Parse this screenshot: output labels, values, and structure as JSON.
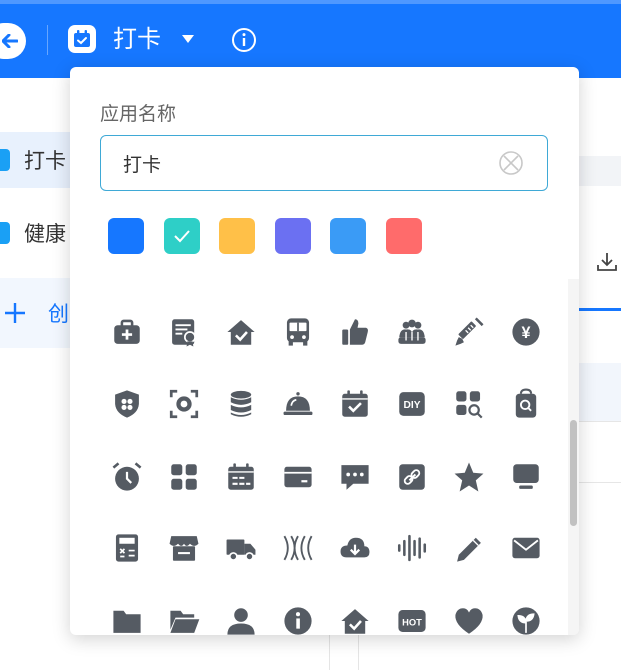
{
  "header": {
    "app_title": "打卡",
    "accent": "#1677ff"
  },
  "sidebar": {
    "items": [
      {
        "label": "打卡",
        "active": true
      },
      {
        "label": "健康",
        "active": false
      }
    ],
    "create_label": "创"
  },
  "popup": {
    "name_label": "应用名称",
    "name_value": "打卡",
    "colors": [
      {
        "name": "blue",
        "hex": "#1677ff",
        "selected": false
      },
      {
        "name": "teal",
        "hex": "#2ecfc7",
        "selected": true
      },
      {
        "name": "orange",
        "hex": "#ffc048",
        "selected": false
      },
      {
        "name": "indigo",
        "hex": "#6b70f2",
        "selected": false
      },
      {
        "name": "sky",
        "hex": "#3a9bf6",
        "selected": false
      },
      {
        "name": "red",
        "hex": "#ff6b6b",
        "selected": false
      }
    ],
    "icons": [
      "medical-kit-icon",
      "certificate-icon",
      "home-check-icon",
      "bus-icon",
      "thumbs-up-icon",
      "group-icon",
      "syringe-icon",
      "yen-icon",
      "shield-icon",
      "focus-icon",
      "database-icon",
      "service-bell-icon",
      "calendar-check-icon",
      "diy-icon",
      "apps-search-icon",
      "search-bag-icon",
      "alarm-icon",
      "grid-icon",
      "calendar-icon",
      "card-icon",
      "chat-icon",
      "link-icon",
      "star-icon",
      "monitor-icon",
      "calculator-icon",
      "store-icon",
      "truck-icon",
      "wave-icon",
      "cloud-download-icon",
      "audio-icon",
      "pencil-icon",
      "mail-icon",
      "folder-icon",
      "folder-open-icon",
      "user-icon",
      "info-icon",
      "home-check-icon",
      "hot-icon",
      "heart-icon",
      "plant-icon"
    ],
    "diy_text": "DIY",
    "hot_text": "HOT",
    "yen_text": "¥"
  }
}
